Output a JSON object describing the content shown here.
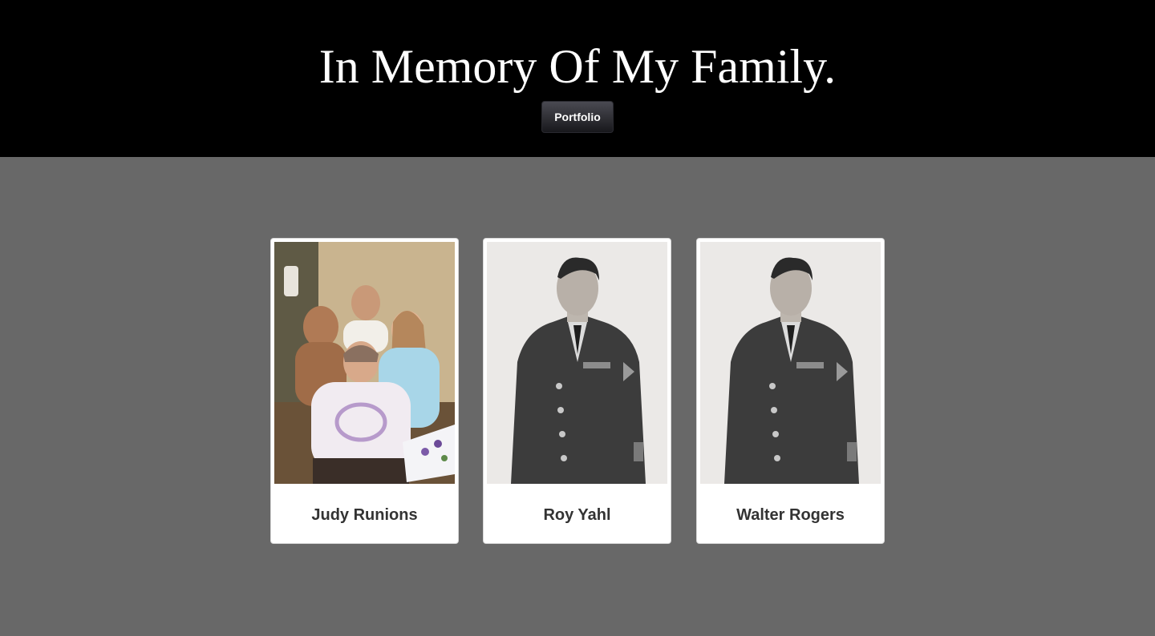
{
  "header": {
    "title": "In Memory Of My Family.",
    "portfolio_label": "Portfolio"
  },
  "cards": [
    {
      "name": "Judy Runions",
      "photo": "family-color-photo"
    },
    {
      "name": "Roy Yahl",
      "photo": "soldier-bw-photo"
    },
    {
      "name": "Walter Rogers",
      "photo": "soldier-bw-photo"
    }
  ],
  "colors": {
    "header_bg": "#000000",
    "page_bg": "#686868",
    "card_bg": "#ffffff",
    "name_text": "#333333"
  }
}
